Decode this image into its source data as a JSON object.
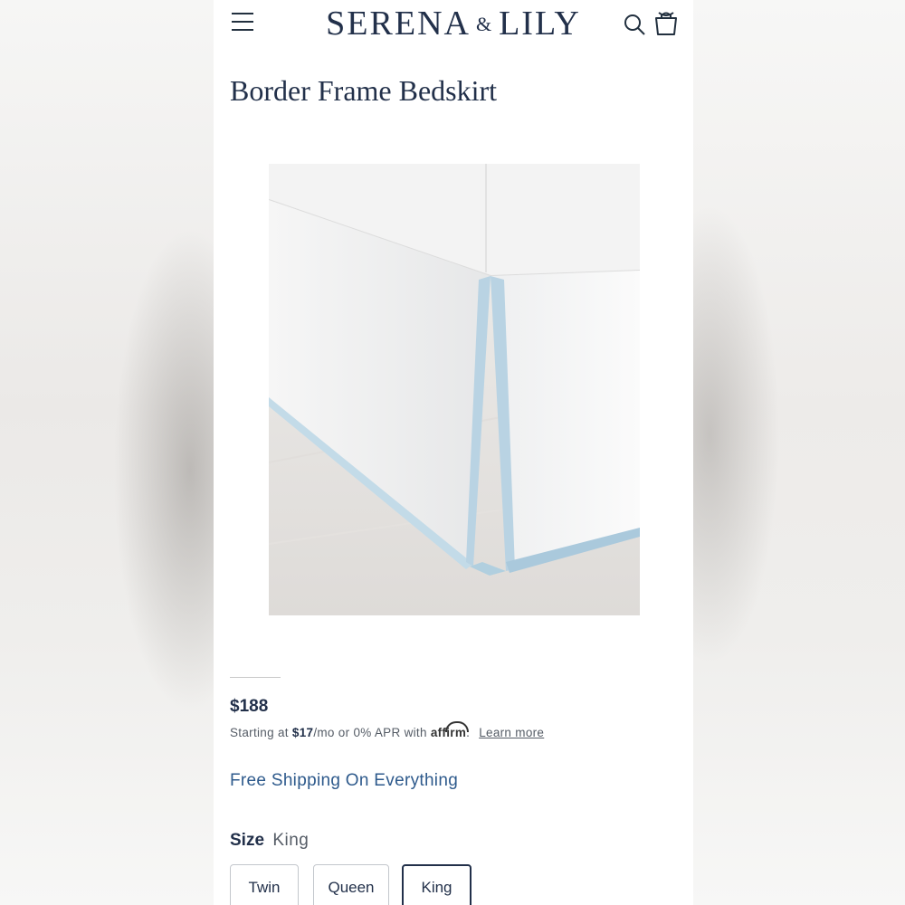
{
  "header": {
    "logo_left": "SERENA",
    "logo_amp": "&",
    "logo_right": "LILY"
  },
  "product": {
    "title": "Border Frame Bedskirt",
    "price": "$188",
    "financing": {
      "prefix": "Starting at ",
      "monthly": "$17",
      "suffix": "/mo or 0% APR with ",
      "brand": "affirm",
      "period": ".",
      "learn_more": "Learn more"
    },
    "shipping": "Free Shipping On Everything",
    "size": {
      "label": "Size",
      "selected": "King",
      "options": [
        "Twin",
        "Queen",
        "King"
      ]
    }
  },
  "colors": {
    "navy": "#22304a",
    "link_blue": "#2e5a8c",
    "trim_blue": "#b9d3e3"
  },
  "icons": [
    "menu-icon",
    "search-icon",
    "shopping-bag-icon"
  ]
}
